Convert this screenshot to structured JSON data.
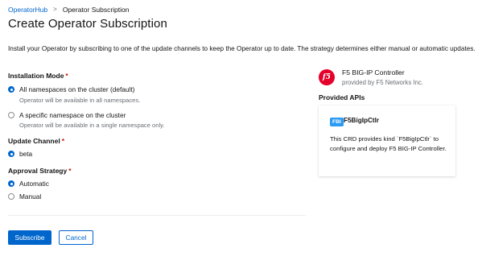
{
  "breadcrumb": {
    "link_label": "OperatorHub",
    "separator": ">",
    "current_label": "Operator Subscription"
  },
  "page": {
    "title": "Create Operator Subscription",
    "description": "Install your Operator by subscribing to one of the update channels to keep the Operator up to date. The strategy determines either manual or automatic updates."
  },
  "installation_mode": {
    "label": "Installation Mode",
    "required_mark": "*",
    "options": [
      {
        "label": "All namespaces on the cluster (default)",
        "help": "Operator will be available in all namespaces.",
        "selected": true
      },
      {
        "label": "A specific namespace on the cluster",
        "help": "Operator will be available in a single namespace only.",
        "selected": false
      }
    ]
  },
  "update_channel": {
    "label": "Update Channel",
    "required_mark": "*",
    "options": [
      {
        "label": "beta",
        "selected": true
      }
    ]
  },
  "approval_strategy": {
    "label": "Approval Strategy",
    "required_mark": "*",
    "options": [
      {
        "label": "Automatic",
        "selected": true
      },
      {
        "label": "Manual",
        "selected": false
      }
    ]
  },
  "actions": {
    "subscribe_label": "Subscribe",
    "cancel_label": "Cancel"
  },
  "operator": {
    "logo_text": "f5",
    "name": "F5 BIG-IP Controller",
    "provider": "provided by F5 Networks Inc."
  },
  "provided_apis": {
    "heading": "Provided APIs",
    "items": [
      {
        "badge": "FBI",
        "name": "F5BigIpCtlr",
        "description": "This CRD provides kind `F5BigIpCtlr` to configure and deploy F5 BIG-IP Controller."
      }
    ]
  },
  "colors": {
    "primary": "#0066cc",
    "required": "#c9190b",
    "logo_red": "#e4002b",
    "api_badge": "#2b9af3",
    "help_text": "#6a6e73"
  }
}
